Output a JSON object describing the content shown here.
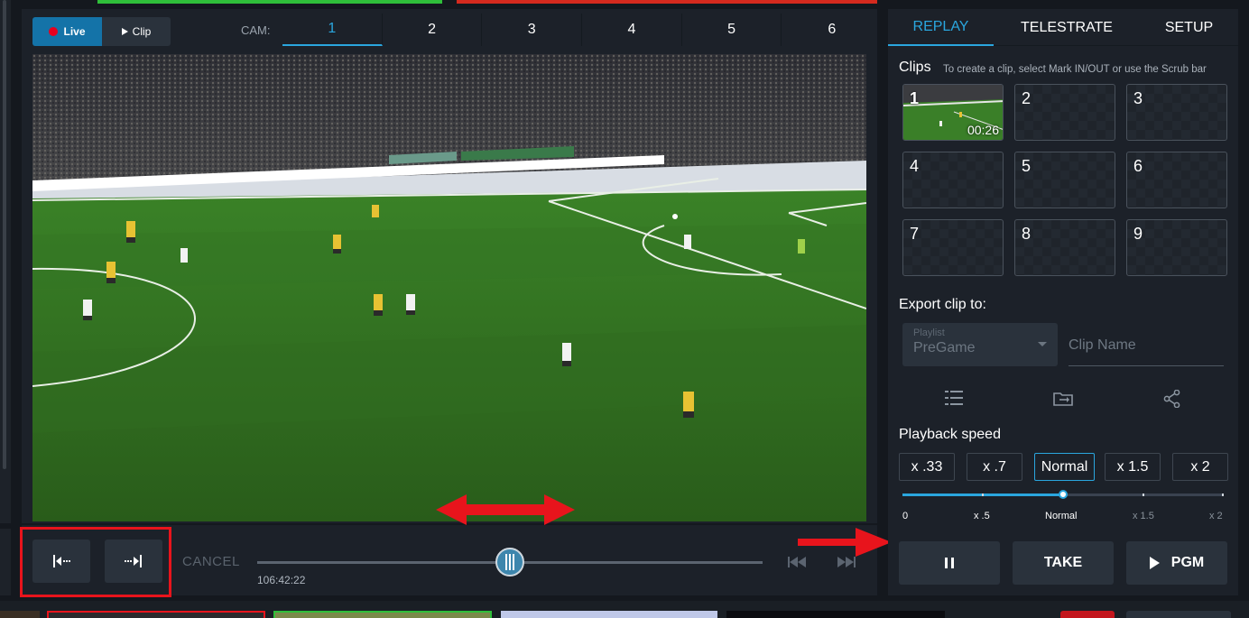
{
  "mode": {
    "live_label": "Live",
    "clip_label": "Clip"
  },
  "cameras": {
    "label": "CAM:",
    "tabs": [
      "1",
      "2",
      "3",
      "4",
      "5",
      "6"
    ],
    "active": "1"
  },
  "transport": {
    "cancel_label": "CANCEL",
    "timecode": "106:42:22"
  },
  "right_tabs": [
    "REPLAY",
    "TELESTRATE",
    "SETUP"
  ],
  "clips": {
    "title": "Clips",
    "hint": "To create a clip, select Mark IN/OUT or use the Scrub bar",
    "slots": [
      "1",
      "2",
      "3",
      "4",
      "5",
      "6",
      "7",
      "8",
      "9"
    ],
    "first_duration": "00:26"
  },
  "export": {
    "label": "Export clip to:",
    "playlist_caption": "Playlist",
    "playlist_value": "PreGame",
    "clip_name_placeholder": "Clip Name"
  },
  "speed": {
    "label": "Playback speed",
    "buttons": [
      "x .33",
      "x .7",
      "Normal",
      "x 1.5",
      "x 2"
    ],
    "active": "Normal",
    "scale_labels": [
      "0",
      "x .5",
      "Normal",
      "x 1.5",
      "x 2"
    ]
  },
  "actions": {
    "take_label": "TAKE",
    "pgm_label": "PGM"
  },
  "colors": {
    "accent": "#2aa6de",
    "record": "#e8001e",
    "annotation": "#e8141c"
  }
}
